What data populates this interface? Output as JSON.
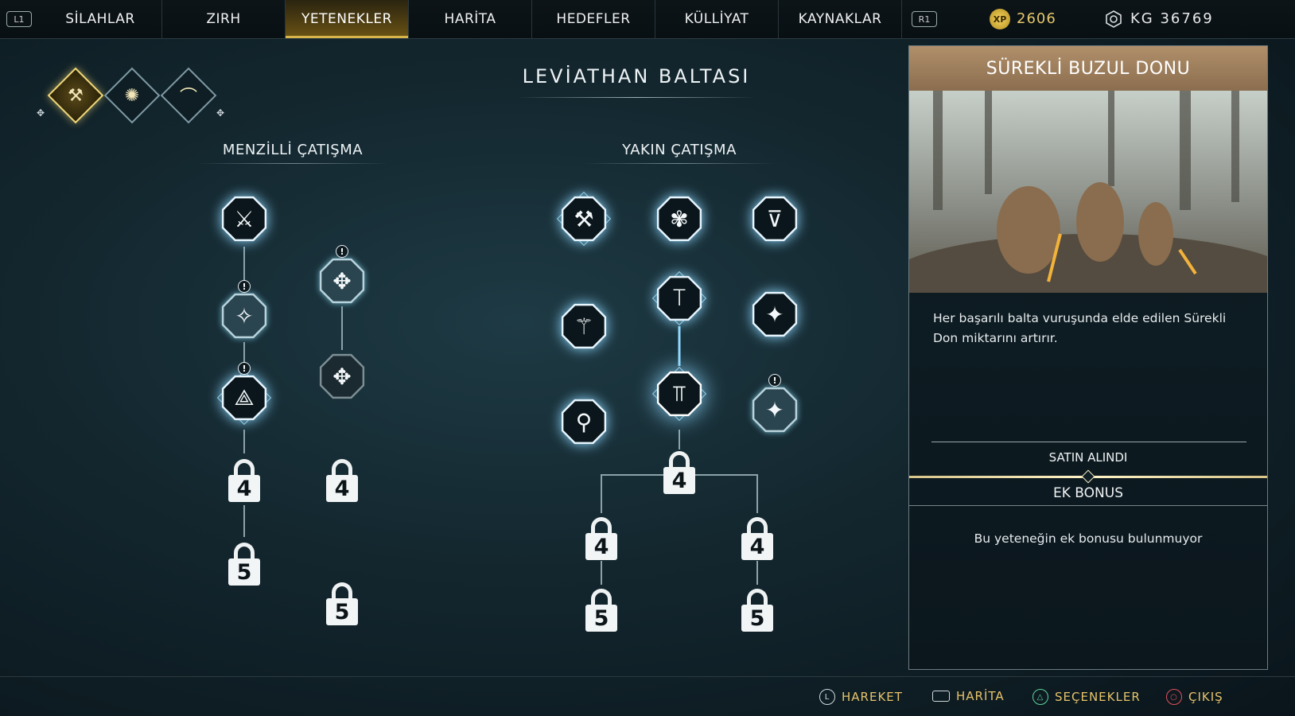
{
  "topbar": {
    "left_button": "L1",
    "right_button": "R1",
    "tabs": [
      {
        "label": "SİLAHLAR"
      },
      {
        "label": "ZIRH"
      },
      {
        "label": "YETENEKLER",
        "active": true
      },
      {
        "label": "HARİTA"
      },
      {
        "label": "HEDEFLER"
      },
      {
        "label": "KÜLLİYAT"
      },
      {
        "label": "KAYNAKLAR"
      }
    ],
    "xp_icon": "XP",
    "xp": "2606",
    "hacksilver": "KG 36769"
  },
  "weapon_selector": {
    "items": [
      {
        "icon": "axe-icon",
        "selected": true
      },
      {
        "icon": "shield-icon",
        "selected": false
      },
      {
        "icon": "bow-icon",
        "selected": false
      }
    ]
  },
  "tree": {
    "title": "LEVİATHAN BALTASI",
    "ranged_title": "MENZİLLİ ÇATIŞMA",
    "melee_title": "YAKIN ÇATIŞMA",
    "warn_symbol": "!",
    "locks": {
      "r_a4": "4",
      "r_a5": "5",
      "r_b4": "4",
      "r_b5": "5",
      "m_c4": "4",
      "m_l4": "4",
      "m_l5": "5",
      "m_r4": "4",
      "m_r5": "5"
    }
  },
  "panel": {
    "title": "SÜREKLİ BUZUL DONU",
    "description": "Her başarılı balta vuruşunda elde edilen Sürekli Don miktarını artırır.",
    "status": "SATIN ALINDI",
    "bonus_title": "EK BONUS",
    "bonus_text": "Bu yeteneğin ek bonusu bulunmuyor"
  },
  "footer": {
    "hints": [
      {
        "icon": "left-stick-icon",
        "glyph": "L",
        "label": "HAREKET"
      },
      {
        "icon": "touchpad-icon",
        "glyph": "",
        "label": "HARİTA"
      },
      {
        "icon": "triangle-button-icon",
        "glyph": "△",
        "label": "SEÇENEKLER"
      },
      {
        "icon": "circle-button-icon",
        "glyph": "○",
        "label": "ÇIKIŞ"
      }
    ]
  },
  "colors": {
    "accent_gold": "#e6c36a",
    "panel_header": "#b08f6a",
    "node_glow": "#8fd8ff"
  }
}
